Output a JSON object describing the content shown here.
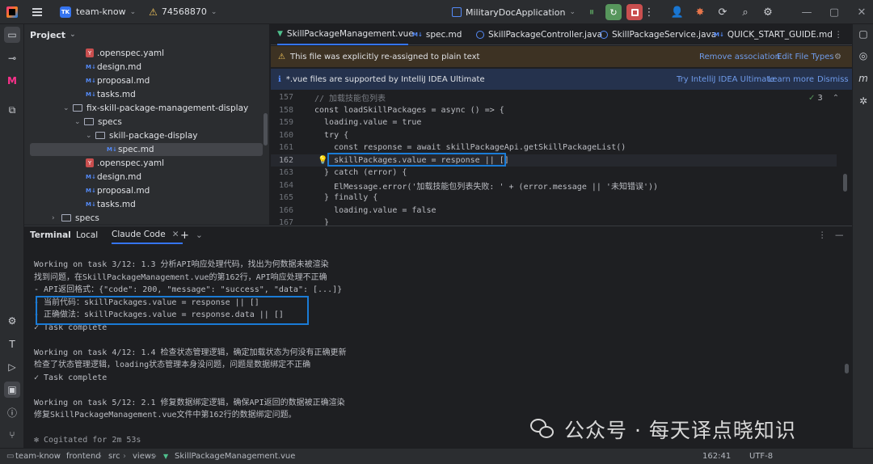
{
  "topbar": {
    "project_badge": "TK",
    "project_name": "team-know",
    "vcs_branch": "74568870",
    "run_config": "MilitaryDocApplication"
  },
  "left_strip": {
    "icons": [
      "folder-icon",
      "commit-icon",
      "plugin-m-icon",
      "structure-icon",
      "settings-gear-icon",
      "text-tool-icon",
      "run-icon",
      "terminal-icon",
      "problems-icon",
      "git-icon"
    ]
  },
  "project_panel": {
    "title": "Project",
    "tree": [
      {
        "label": ".openspec.yaml",
        "type": "yaml"
      },
      {
        "label": "design.md",
        "type": "md"
      },
      {
        "label": "proposal.md",
        "type": "md"
      },
      {
        "label": "tasks.md",
        "type": "md"
      },
      {
        "label": "fix-skill-package-management-display",
        "type": "folder"
      },
      {
        "label": "specs",
        "type": "folder"
      },
      {
        "label": "skill-package-display",
        "type": "folder"
      },
      {
        "label": "spec.md",
        "type": "md"
      },
      {
        "label": ".openspec.yaml",
        "type": "yaml"
      },
      {
        "label": "design.md",
        "type": "md"
      },
      {
        "label": "proposal.md",
        "type": "md"
      },
      {
        "label": "tasks.md",
        "type": "md"
      },
      {
        "label": "specs",
        "type": "folder"
      }
    ]
  },
  "editor": {
    "tabs": [
      {
        "label": "SkillPackageManagement.vue",
        "icon": "vue-icon",
        "active": true
      },
      {
        "label": "spec.md",
        "icon": "md-icon",
        "active": false
      },
      {
        "label": "SkillPackageController.java",
        "icon": "java-icon",
        "active": false
      },
      {
        "label": "SkillPackageService.java",
        "icon": "java-icon",
        "active": false
      },
      {
        "label": "QUICK_START_GUIDE.md",
        "icon": "md-icon",
        "active": false
      }
    ],
    "banner_plain_text": {
      "message": "This file was explicitly re-assigned to plain text",
      "remove": "Remove association",
      "edit": "Edit File Types"
    },
    "banner_ultimate": {
      "message": "*.vue files are supported by IntelliJ IDEA Ultimate",
      "try": "Try IntelliJ IDEA Ultimate",
      "learn": "Learn more",
      "dismiss": "Dismiss"
    },
    "inspection_count": "3",
    "lines": [
      {
        "n": "157",
        "text": "// 加载技能包列表"
      },
      {
        "n": "158",
        "text": "const loadSkillPackages = async () => {"
      },
      {
        "n": "159",
        "text": "  loading.value = true"
      },
      {
        "n": "160",
        "text": "  try {"
      },
      {
        "n": "161",
        "text": "    const response = await skillPackageApi.getSkillPackageList()"
      },
      {
        "n": "162",
        "text": "    skillPackages.value = response || []"
      },
      {
        "n": "163",
        "text": "  } catch (error) {"
      },
      {
        "n": "164",
        "text": "    ElMessage.error('加载技能包列表失败: ' + (error.message || '未知错误'))"
      },
      {
        "n": "165",
        "text": "  } finally {"
      },
      {
        "n": "166",
        "text": "    loading.value = false"
      },
      {
        "n": "167",
        "text": "  }"
      }
    ]
  },
  "terminal": {
    "tabs": [
      "Terminal",
      "Local",
      "Claude Code"
    ],
    "lines": [
      "Working on task 3/12: 1.3 分析API响应处理代码，找出为何数据未被渲染",
      "找到问题，在SkillPackageManagement.vue的第162行，API响应处理不正确",
      "- API返回格式：{\"code\": 200, \"message\": \"success\", \"data\": [...]}",
      "- 当前代码：skillPackages.value = response || []",
      "- 正确做法：skillPackages.value = response.data || []",
      "✓ Task complete",
      "",
      "Working on task 4/12: 1.4 检查状态管理逻辑，确定加载状态为何没有正确更新",
      "检查了状态管理逻辑，loading状态管理本身没问题，问题是数据绑定不正确",
      "✓ Task complete",
      "",
      "Working on task 5/12: 2.1 修复数据绑定逻辑，确保API返回的数据被正确渲染",
      "修复SkillPackageManagement.vue文件中第162行的数据绑定问题。",
      "",
      "✻ Cogitated for 2m 53s"
    ],
    "watermark": "公众号 · 每天译点晓知识"
  },
  "status_bar": {
    "breadcrumb": [
      "team-know",
      "frontend",
      "src",
      "views",
      "SkillPackageManagement.vue"
    ],
    "position": "162:41",
    "encoding": "UTF-8"
  }
}
